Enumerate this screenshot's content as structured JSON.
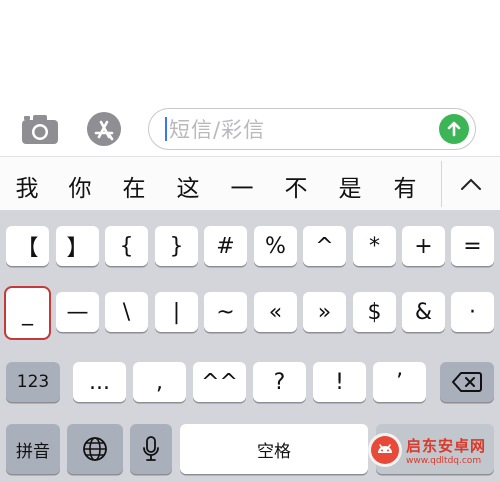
{
  "message_bar": {
    "placeholder": "短信/彩信",
    "camera_icon": "camera-icon",
    "appstore_icon": "app-store-icon",
    "send_icon": "arrow-up-icon",
    "send_color": "#3cb556"
  },
  "candidates": {
    "items": [
      "我",
      "你",
      "在",
      "这",
      "一",
      "不",
      "是",
      "有"
    ],
    "expand_icon": "chevron-up-icon"
  },
  "keyboard": {
    "row1": [
      "【",
      "】",
      "{",
      "}",
      "#",
      "%",
      "^",
      "*",
      "+",
      "="
    ],
    "row2": [
      "_",
      "—",
      "\\",
      "|",
      "~",
      "«",
      "»",
      "$",
      "&",
      "·"
    ],
    "row3": {
      "mode_key": "123",
      "keys": [
        "...",
        ",",
        "^^",
        "?",
        "!",
        "’"
      ],
      "delete_icon": "backspace-icon"
    },
    "row4": {
      "pinyin_key": "拼音",
      "globe_icon": "globe-icon",
      "mic_icon": "microphone-icon",
      "space_key": "空格"
    }
  },
  "watermark": {
    "name": "启东安卓网",
    "url": "www.qdltdq.com"
  }
}
